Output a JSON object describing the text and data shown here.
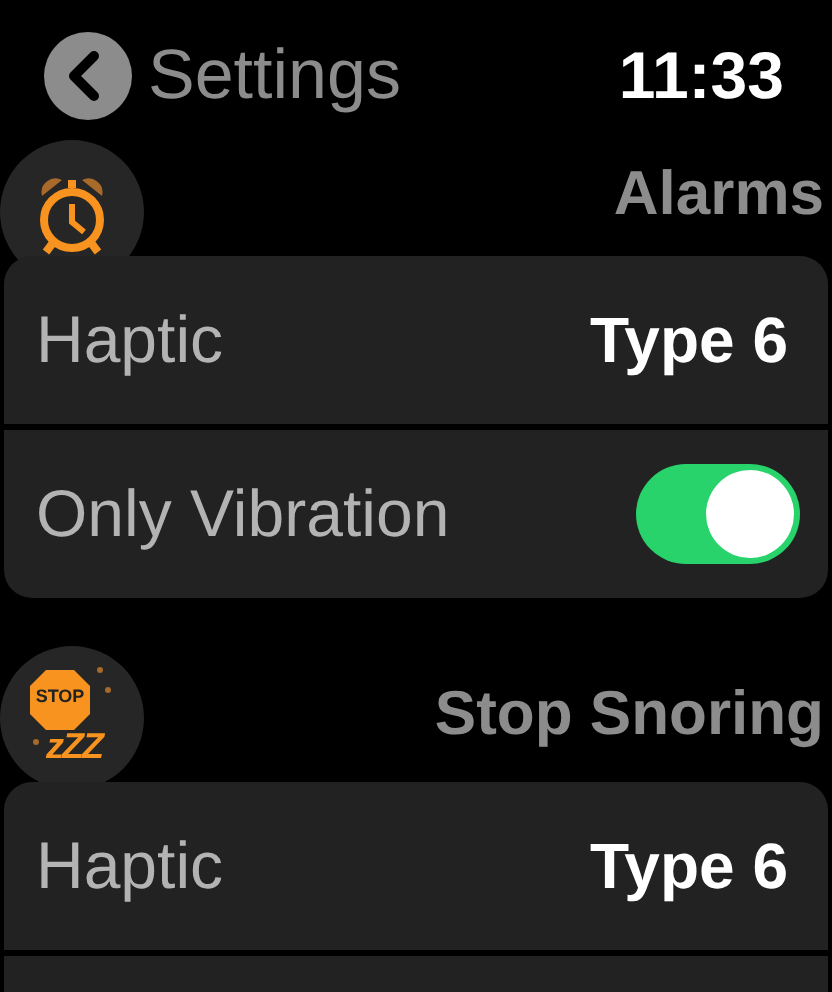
{
  "header": {
    "back_label": "Settings",
    "time": "11:33"
  },
  "sections": [
    {
      "title": "Alarms",
      "rows": [
        {
          "kind": "value",
          "label": "Haptic",
          "value": "Type 6"
        },
        {
          "kind": "toggle",
          "label": "Only Vibration",
          "on": true
        }
      ]
    },
    {
      "title": "Stop Snoring",
      "icon_text": "STOP",
      "icon_sub": "zZZ",
      "rows": [
        {
          "kind": "value",
          "label": "Haptic",
          "value": "Type 6"
        },
        {
          "kind": "blank"
        }
      ]
    }
  ]
}
